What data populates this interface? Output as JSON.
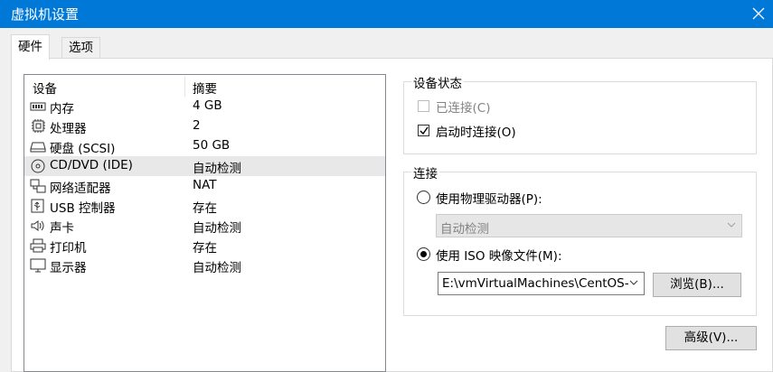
{
  "window": {
    "title": "虚拟机设置"
  },
  "tabs": [
    {
      "label": "硬件"
    },
    {
      "label": "选项"
    }
  ],
  "device_list": {
    "columns": [
      "设备",
      "摘要"
    ],
    "rows": [
      {
        "name": "内存",
        "value": "4 GB",
        "icon": "memory-icon"
      },
      {
        "name": "处理器",
        "value": "2",
        "icon": "cpu-icon"
      },
      {
        "name": "硬盘 (SCSI)",
        "value": "50 GB",
        "icon": "harddisk-icon"
      },
      {
        "name": "CD/DVD (IDE)",
        "value": "自动检测",
        "icon": "cd-dvd-icon",
        "selected": true
      },
      {
        "name": "网络适配器",
        "value": "NAT",
        "icon": "network-adapter-icon"
      },
      {
        "name": "USB 控制器",
        "value": "存在",
        "icon": "usb-icon"
      },
      {
        "name": "声卡",
        "value": "自动检测",
        "icon": "speaker-icon"
      },
      {
        "name": "打印机",
        "value": "存在",
        "icon": "printer-icon"
      },
      {
        "name": "显示器",
        "value": "自动检测",
        "icon": "monitor-icon"
      }
    ]
  },
  "device_status": {
    "legend": "设备状态",
    "connected_label": "已连接(C)",
    "connected_checked": false,
    "connected_enabled": false,
    "connect_on_start_label": "启动时连接(O)",
    "connect_on_start_checked": true
  },
  "connection": {
    "legend": "连接",
    "physical_drive_label": "使用物理驱动器(P):",
    "physical_drive_selected": false,
    "physical_drive_value": "自动检测",
    "iso_label": "使用 ISO 映像文件(M):",
    "iso_selected": true,
    "iso_path": "E:\\vmVirtualMachines\\CentOS-",
    "browse_label": "浏览(B)..."
  },
  "advanced_label": "高级(V)..."
}
